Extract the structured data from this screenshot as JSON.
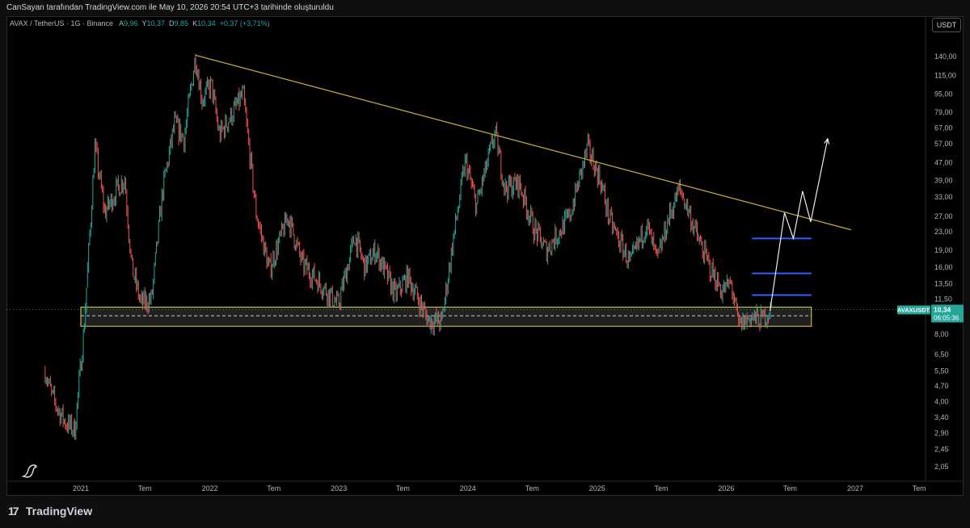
{
  "header": {
    "note": "CanSayan tarafından TradingView.com ile May 10, 2026 20:54 UTC+3 tarihinde oluşturuldu"
  },
  "legend": {
    "symbol": "AVAX / TetherUS · 1G · Binance",
    "a_key": "A",
    "a_val": "9,96",
    "y_key": "Y",
    "y_val": "10,37",
    "d_key": "D",
    "d_val": "9,85",
    "k_key": "K",
    "k_val": "10,34",
    "change": "+0,37 (+3,71%)"
  },
  "currency_button": "USDT",
  "price_tag": {
    "symbol": "AVAXUSDT",
    "price": "10,34",
    "timer": "06:05:36"
  },
  "footer": {
    "brand": "TradingView"
  },
  "colors": {
    "up": "#26a69a",
    "down": "#ef5350",
    "trendline": "#c8b23a",
    "zone": "#e6d64c",
    "target_lines": "#2962ff",
    "projection": "#ffffff",
    "tag": "#26a69a"
  },
  "icons": {
    "logo": "tradingview-logo-icon",
    "dino": "dino-icon"
  },
  "chart_data": {
    "type": "candlestick",
    "scale": "log",
    "grid": false,
    "y_ticks": [
      140,
      115,
      95,
      79,
      67,
      57,
      47,
      39,
      33,
      27,
      23,
      19,
      16,
      13.5,
      11.5,
      8,
      6.5,
      5.5,
      4.7,
      4,
      3.4,
      2.9,
      2.45,
      2.05
    ],
    "y_tick_labels": [
      "140,00",
      "115,00",
      "95,00",
      "79,00",
      "67,00",
      "57,00",
      "47,00",
      "39,00",
      "33,00",
      "27,00",
      "23,00",
      "19,00",
      "16,00",
      "13,50",
      "11,50",
      "8,00",
      "6,50",
      "5,50",
      "4,70",
      "4,00",
      "3,40",
      "2,90",
      "2,45",
      "2,05"
    ],
    "x_ticks": [
      {
        "label": "2021",
        "date": "2021-01-01"
      },
      {
        "label": "Tem",
        "date": "2021-07-01"
      },
      {
        "label": "2022",
        "date": "2022-01-01"
      },
      {
        "label": "Tem",
        "date": "2022-07-01"
      },
      {
        "label": "2023",
        "date": "2023-01-01"
      },
      {
        "label": "Tem",
        "date": "2023-07-01"
      },
      {
        "label": "2024",
        "date": "2024-01-01"
      },
      {
        "label": "Tem",
        "date": "2024-07-01"
      },
      {
        "label": "2025",
        "date": "2025-01-01"
      },
      {
        "label": "Tem",
        "date": "2025-07-01"
      },
      {
        "label": "2026",
        "date": "2026-01-01"
      },
      {
        "label": "Tem",
        "date": "2026-07-01"
      },
      {
        "label": "2027",
        "date": "2027-01-01"
      },
      {
        "label": "Tem",
        "date": "2027-07-01"
      }
    ],
    "price_path": [
      [
        "2020-09-22",
        5.5
      ],
      [
        "2020-10-10",
        4.3
      ],
      [
        "2020-11-01",
        3.6
      ],
      [
        "2020-11-20",
        3.2
      ],
      [
        "2020-12-15",
        3.0
      ],
      [
        "2021-01-10",
        8.5
      ],
      [
        "2021-02-10",
        55
      ],
      [
        "2021-03-10",
        28
      ],
      [
        "2021-04-10",
        35
      ],
      [
        "2021-05-05",
        40
      ],
      [
        "2021-05-25",
        16
      ],
      [
        "2021-06-20",
        11
      ],
      [
        "2021-07-20",
        11.5
      ],
      [
        "2021-08-20",
        35
      ],
      [
        "2021-09-23",
        70
      ],
      [
        "2021-10-20",
        60
      ],
      [
        "2021-11-21",
        140
      ],
      [
        "2021-12-10",
        90
      ],
      [
        "2022-01-05",
        105
      ],
      [
        "2022-01-28",
        62
      ],
      [
        "2022-03-10",
        80
      ],
      [
        "2022-04-05",
        95
      ],
      [
        "2022-05-12",
        28
      ],
      [
        "2022-06-18",
        15.5
      ],
      [
        "2022-08-10",
        27
      ],
      [
        "2022-09-20",
        16.5
      ],
      [
        "2022-11-10",
        13.5
      ],
      [
        "2022-12-30",
        10.8
      ],
      [
        "2023-02-15",
        22
      ],
      [
        "2023-03-15",
        16
      ],
      [
        "2023-04-15",
        19
      ],
      [
        "2023-06-10",
        12
      ],
      [
        "2023-07-15",
        14.5
      ],
      [
        "2023-09-10",
        9.3
      ],
      [
        "2023-10-19",
        9.1
      ],
      [
        "2023-11-20",
        21
      ],
      [
        "2023-12-25",
        48
      ],
      [
        "2024-01-25",
        30
      ],
      [
        "2024-03-18",
        64
      ],
      [
        "2024-04-15",
        36
      ],
      [
        "2024-05-25",
        38
      ],
      [
        "2024-07-05",
        24
      ],
      [
        "2024-08-10",
        19
      ],
      [
        "2024-10-15",
        27
      ],
      [
        "2024-12-05",
        55
      ],
      [
        "2025-01-10",
        39
      ],
      [
        "2025-02-05",
        26
      ],
      [
        "2025-04-05",
        16.5
      ],
      [
        "2025-05-20",
        25
      ],
      [
        "2025-06-20",
        17
      ],
      [
        "2025-07-20",
        26
      ],
      [
        "2025-08-22",
        36
      ],
      [
        "2025-09-15",
        29
      ],
      [
        "2025-10-10",
        22
      ],
      [
        "2025-11-15",
        16
      ],
      [
        "2025-12-20",
        12.5
      ],
      [
        "2026-01-15",
        13.5
      ],
      [
        "2026-02-05",
        8.7
      ],
      [
        "2026-03-10",
        9.6
      ],
      [
        "2026-04-10",
        9.3
      ],
      [
        "2026-05-10",
        10.34
      ]
    ],
    "trendline": {
      "from": [
        "2021-11-21",
        142
      ],
      "to": [
        "2026-12-20",
        23.5
      ]
    },
    "support_zone": {
      "from": "2021-01-01",
      "to": "2026-08-30",
      "top": 10.6,
      "bottom": 8.7,
      "mid": 9.7
    },
    "target_levels": [
      {
        "price": 21.5,
        "from": "2026-03-15",
        "to": "2026-08-30"
      },
      {
        "price": 15.0,
        "from": "2026-03-15",
        "to": "2026-08-30"
      },
      {
        "price": 12.0,
        "from": "2026-03-15",
        "to": "2026-08-30"
      }
    ],
    "projection_path": [
      [
        "2026-05-05",
        10.2
      ],
      [
        "2026-06-15",
        28
      ],
      [
        "2026-07-10",
        21.5
      ],
      [
        "2026-08-05",
        35
      ],
      [
        "2026-08-28",
        25.5
      ],
      [
        "2026-10-15",
        60
      ]
    ],
    "current_price": 10.34
  }
}
